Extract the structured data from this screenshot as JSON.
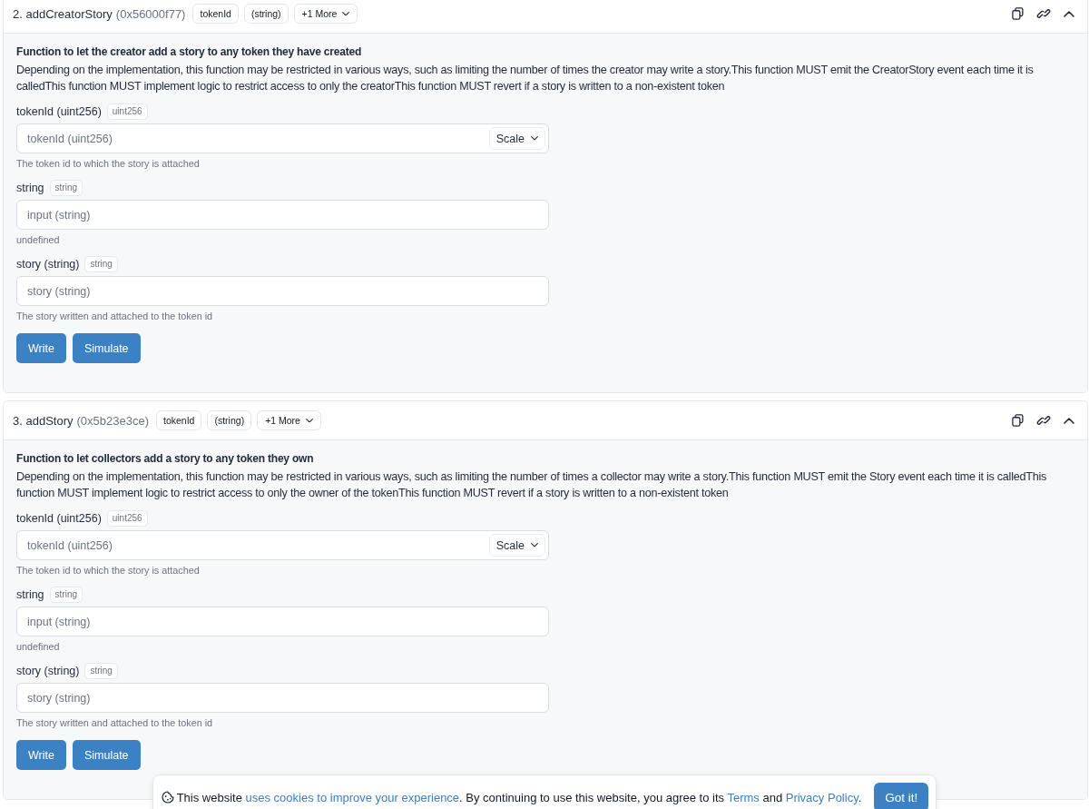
{
  "functions": [
    {
      "title": "2. addCreatorStory",
      "selector": "(0x56000f77)",
      "param_tags": [
        "tokenId",
        "(string)"
      ],
      "more_tag": "+1 More",
      "expanded": true,
      "summary": "Function to let the creator add a story to any token they have created",
      "description": "Depending on the implementation, this function may be restricted in various ways, such as limiting the number of times the creator may write a story.This function MUST emit the CreatorStory event each time it is calledThis function MUST implement logic to restrict access to only the creatorThis function MUST revert if a story is written to a non-existent token",
      "inputs": [
        {
          "label": "tokenId (uint256)",
          "type": "uint256",
          "placeholder": "tokenId (uint256)",
          "unit_select": "Scale",
          "help": "The token id to which the story is attached"
        },
        {
          "label": "string",
          "type": "string",
          "placeholder": "input (string)",
          "help": "undefined"
        },
        {
          "label": "story (string)",
          "type": "string",
          "placeholder": "story (string)",
          "help": "The story written and attached to the token id"
        }
      ],
      "buttons": [
        "Write",
        "Simulate"
      ]
    },
    {
      "title": "3. addStory",
      "selector": "(0x5b23e3ce)",
      "param_tags": [
        "tokenId",
        "(string)"
      ],
      "more_tag": "+1 More",
      "expanded": true,
      "summary": "Function to let collectors add a story to any token they own",
      "description": "Depending on the implementation, this function may be restricted in various ways, such as limiting the number of times a collector may write a story.This function MUST emit the Story event each time it is calledThis function MUST implement logic to restrict access to only the owner of the tokenThis function MUST revert if a story is written to a non-existent token",
      "inputs": [
        {
          "label": "tokenId (uint256)",
          "type": "uint256",
          "placeholder": "tokenId (uint256)",
          "unit_select": "Scale",
          "help": "The token id to which the story is attached"
        },
        {
          "label": "string",
          "type": "string",
          "placeholder": "input (string)",
          "help": "undefined"
        },
        {
          "label": "story (string)",
          "type": "string",
          "placeholder": "story (string)",
          "help": "The story written and attached to the token id"
        }
      ],
      "buttons": [
        "Write",
        "Simulate"
      ]
    }
  ],
  "cookie_banner": {
    "parts": [
      {
        "kind": "text",
        "text": "This website "
      },
      {
        "kind": "link",
        "text": "uses cookies to improve your experience"
      },
      {
        "kind": "text",
        "text": ". By continuing to use this website, you agree to its "
      },
      {
        "kind": "link",
        "text": "Terms"
      },
      {
        "kind": "text",
        "text": " and "
      },
      {
        "kind": "link",
        "text": "Privacy Policy"
      },
      {
        "kind": "text",
        "text": "."
      }
    ],
    "button": "Got it!"
  }
}
